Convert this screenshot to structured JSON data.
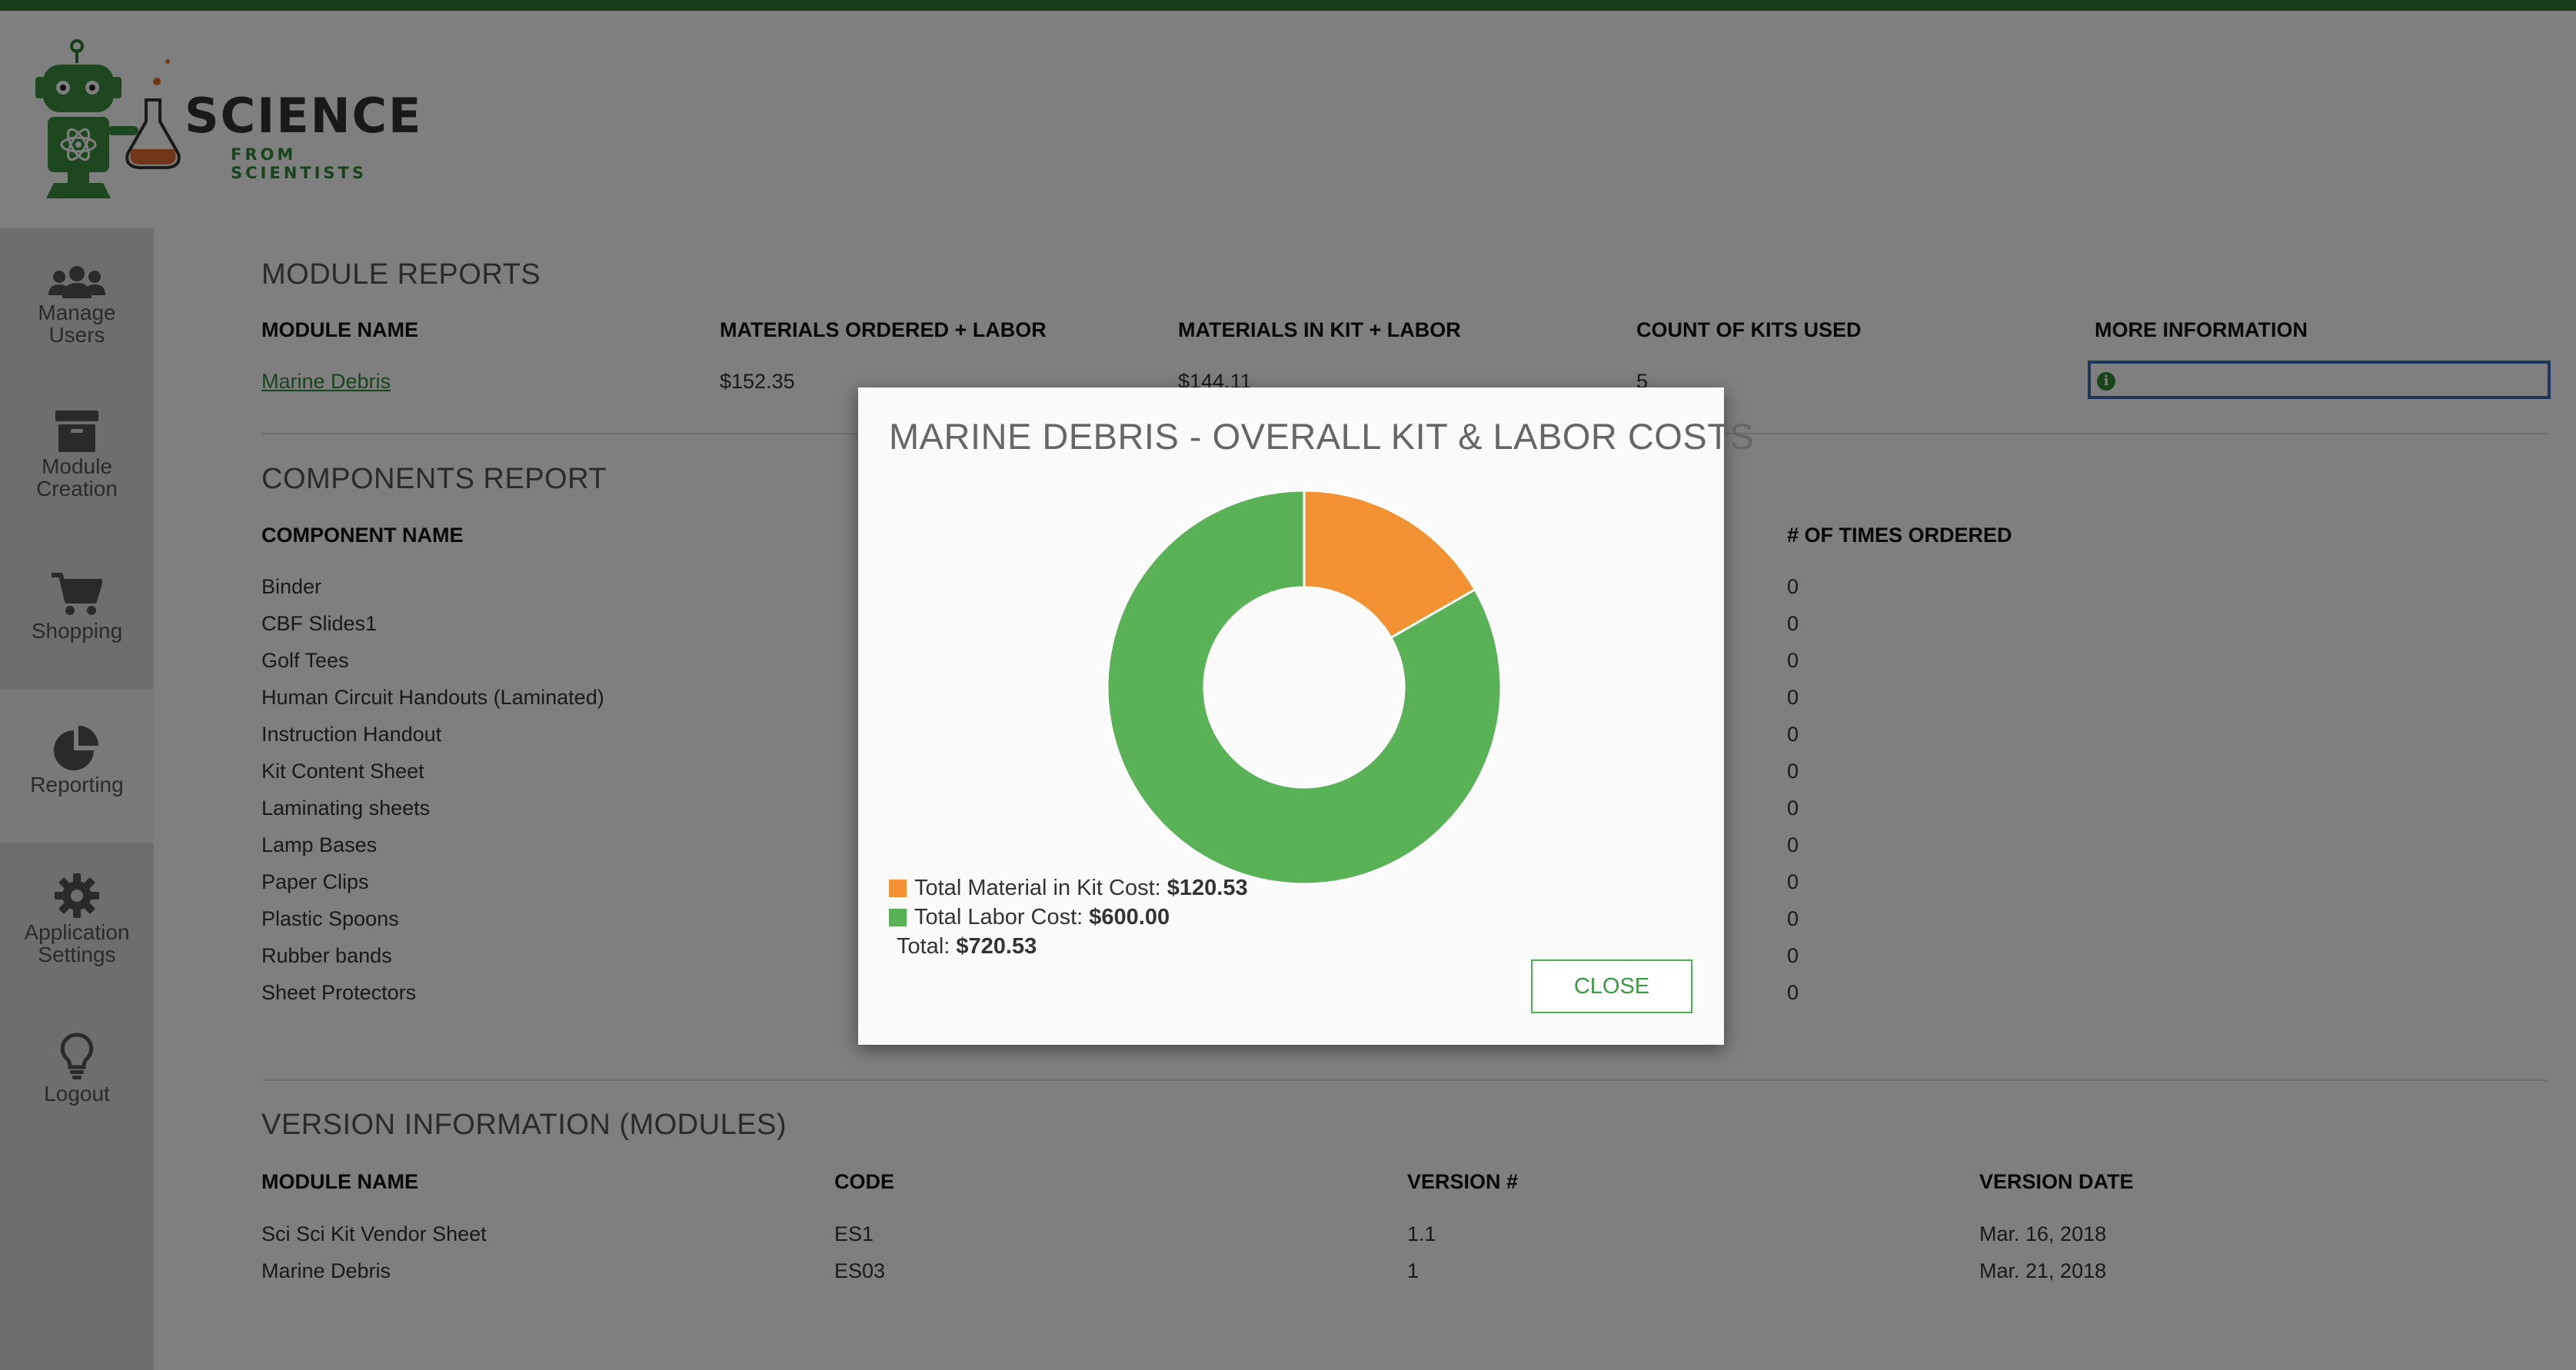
{
  "brand": {
    "title": "SCIENCE",
    "subtitle": "FROM SCIENTISTS",
    "accent": "#2e7d32"
  },
  "sidebar": {
    "items": [
      {
        "label_line1": "Manage",
        "label_line2": "Users",
        "icon": "users-icon"
      },
      {
        "label_line1": "Module",
        "label_line2": "Creation",
        "icon": "archive-box-icon"
      },
      {
        "label_line1": "Shopping",
        "label_line2": "",
        "icon": "cart-icon"
      },
      {
        "label_line1": "Reporting",
        "label_line2": "",
        "icon": "pie-chart-icon",
        "active": true
      },
      {
        "label_line1": "Application",
        "label_line2": "Settings",
        "icon": "gear-icon"
      },
      {
        "label_line1": "Logout",
        "label_line2": "",
        "icon": "lightbulb-icon"
      }
    ]
  },
  "module_reports": {
    "title": "MODULE REPORTS",
    "headers": [
      "MODULE NAME",
      "MATERIALS ORDERED + LABOR",
      "MATERIALS IN KIT + LABOR",
      "COUNT OF KITS USED",
      "MORE INFORMATION"
    ],
    "row": {
      "name": "Marine Debris",
      "ordered": "$152.35",
      "in_kit": "$144.11",
      "count": "5"
    }
  },
  "components_report": {
    "title": "COMPONENTS REPORT",
    "headers": {
      "name": "COMPONENT NAME",
      "times": "# OF TIMES ORDERED"
    },
    "rows": [
      {
        "name": "Binder",
        "times": "0"
      },
      {
        "name": "CBF Slides1",
        "times": "0"
      },
      {
        "name": "Golf Tees",
        "times": "0"
      },
      {
        "name": "Human Circuit Handouts (Laminated)",
        "times": "0"
      },
      {
        "name": "Instruction Handout",
        "times": "0"
      },
      {
        "name": "Kit Content Sheet",
        "times": "0"
      },
      {
        "name": "Laminating sheets",
        "times": "0"
      },
      {
        "name": "Lamp Bases",
        "times": "0"
      },
      {
        "name": "Paper Clips",
        "times": "0"
      },
      {
        "name": "Plastic Spoons",
        "times": "0"
      },
      {
        "name": "Rubber bands",
        "times": "0"
      },
      {
        "name": "Sheet Protectors",
        "times": "0"
      }
    ]
  },
  "version_info": {
    "title": "VERSION INFORMATION (MODULES)",
    "headers": [
      "MODULE NAME",
      "CODE",
      "VERSION #",
      "VERSION DATE"
    ],
    "rows": [
      {
        "name": "Sci Sci Kit Vendor Sheet",
        "code": "ES1",
        "version": "1.1",
        "date": "Mar. 16, 2018"
      },
      {
        "name": "Marine Debris",
        "code": "ES03",
        "version": "1",
        "date": "Mar. 21, 2018"
      }
    ]
  },
  "modal": {
    "title": "MARINE DEBRIS - OVERALL KIT & LABOR COSTS",
    "legend": [
      {
        "label": "Total Material in Kit Cost:",
        "value": "$120.53"
      },
      {
        "label": "Total Labor Cost:",
        "value": "$600.00"
      }
    ],
    "total_label": "Total:",
    "total_value": "$720.53",
    "close_label": "CLOSE"
  },
  "chart_data": {
    "type": "pie",
    "title": "MARINE DEBRIS - OVERALL KIT & LABOR COSTS",
    "donut": true,
    "slices": [
      {
        "label": "Total Material in Kit Cost",
        "value": 120.53,
        "color": "#f39233"
      },
      {
        "label": "Total Labor Cost",
        "value": 600.0,
        "color": "#5ab257"
      }
    ]
  }
}
